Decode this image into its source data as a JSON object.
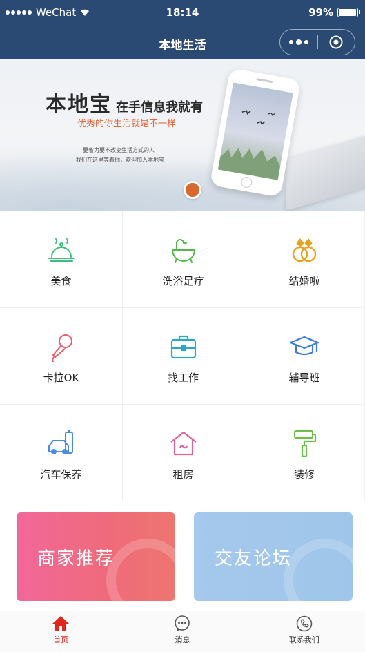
{
  "status_bar": {
    "carrier": "WeChat",
    "time": "18:14",
    "battery": "99%",
    "battery_level": 0.99
  },
  "nav": {
    "title": "本地生活"
  },
  "banner": {
    "title_big": "本地宝",
    "title_small": "在手信息我就有",
    "subtitle": "优秀的你生活就是不一样",
    "desc_line1": "要省力要不改变生活方式的人",
    "desc_line2": "我们在这里等着你，欢迎加入本地宝",
    "slide_count": 2,
    "active_slide": 1
  },
  "services": [
    {
      "label": "美食",
      "icon": "food-cloche-icon",
      "color": "#3dbf7a"
    },
    {
      "label": "洗浴足疗",
      "icon": "bath-tub-icon",
      "color": "#52b848"
    },
    {
      "label": "结婚啦",
      "icon": "wedding-rings-icon",
      "color": "#e8a21d"
    },
    {
      "label": "卡拉OK",
      "icon": "microphone-icon",
      "color": "#ee5b6c"
    },
    {
      "label": "找工作",
      "icon": "briefcase-icon",
      "color": "#2aa9c0"
    },
    {
      "label": "辅导班",
      "icon": "graduation-cap-icon",
      "color": "#3d7ae0"
    },
    {
      "label": "汽车保养",
      "icon": "car-service-icon",
      "color": "#4a8de0"
    },
    {
      "label": "租房",
      "icon": "house-icon",
      "color": "#e0609a"
    },
    {
      "label": "装修",
      "icon": "paint-roller-icon",
      "color": "#6cc04a"
    }
  ],
  "cards": {
    "merchant": "商家推荐",
    "forum": "交友论坛"
  },
  "tabs": [
    {
      "label": "首页",
      "icon": "home-icon",
      "active": true
    },
    {
      "label": "消息",
      "icon": "message-icon",
      "active": false
    },
    {
      "label": "联系我们",
      "icon": "phone-icon",
      "active": false
    }
  ],
  "colors": {
    "nav_bg": "#2b4a73",
    "tab_active": "#e0251d"
  }
}
